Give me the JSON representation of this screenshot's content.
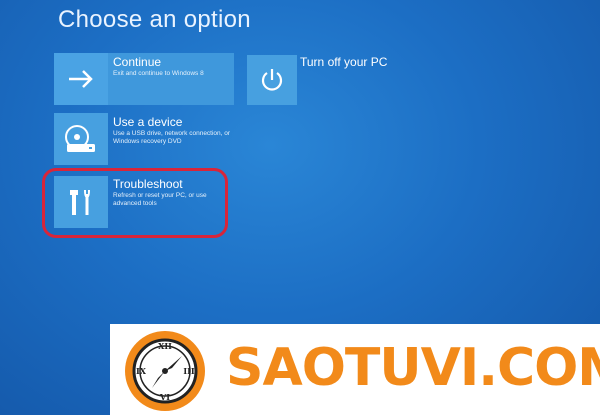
{
  "screen": {
    "title": "Choose an option"
  },
  "options": [
    {
      "id": "continue",
      "label": "Continue",
      "description": "Exit and continue to Windows 8",
      "icon": "arrow-right-icon"
    },
    {
      "id": "use-device",
      "label": "Use a device",
      "description": "Use a USB drive, network connection, or Windows recovery DVD",
      "icon": "disc-drive-icon"
    },
    {
      "id": "troubleshoot",
      "label": "Troubleshoot",
      "description": "Refresh or reset your PC, or use advanced tools",
      "icon": "tools-icon"
    },
    {
      "id": "turn-off",
      "label": "Turn off your PC",
      "icon": "power-icon"
    }
  ],
  "annotation": {
    "color": "#d8253a",
    "target": "troubleshoot"
  },
  "watermark": {
    "text": "SAOTUVI.COM",
    "text_color": "#f28a1a",
    "logo_color": "#f28a1a"
  },
  "colors": {
    "background": "#1c6ec4",
    "tile": "#47a0e0",
    "text": "#ffffff"
  }
}
